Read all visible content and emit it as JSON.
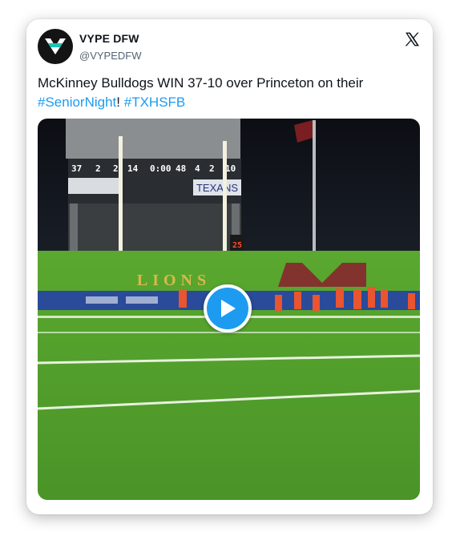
{
  "tweet": {
    "display_name": "VYPE DFW",
    "handle": "@VYPEDFW",
    "text_main": "McKinney Bulldogs WIN 37-10 over Princeton on their ",
    "hashtags": [
      "#SeniorNight",
      "#TXHSFB"
    ],
    "text_sep": "! ",
    "avatar_icon": "vype-logo-icon",
    "platform_icon": "x-logo-icon"
  },
  "media": {
    "type": "video",
    "play_icon": "play-icon",
    "scoreboard": {
      "home": "37",
      "down": "2",
      "togo": "2",
      "ball_on": "14",
      "clock": "0:00",
      "away_extra": "48",
      "qtr": "4",
      "to1": "2",
      "away": "10"
    },
    "banner_text": "TEXANS",
    "end_zone_text": "LIONS",
    "play_clock": "25"
  },
  "colors": {
    "accent": "#1d9bf0",
    "text": "#0f1419",
    "muted": "#536471"
  }
}
